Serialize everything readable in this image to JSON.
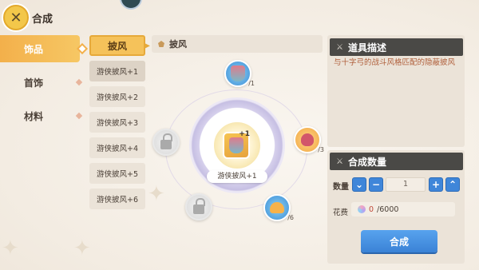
{
  "header": {
    "title": "合成",
    "close_icon": "close-x-icon"
  },
  "categories": [
    {
      "label": "饰品",
      "active": true
    },
    {
      "label": "首饰",
      "active": false
    },
    {
      "label": "材料",
      "active": false
    }
  ],
  "subcategory": {
    "label": "披风"
  },
  "sub_items": [
    "游侠披风+1",
    "游侠披风+2",
    "游侠披风+3",
    "游侠披风+4",
    "游侠披风+5",
    "游侠披风+6"
  ],
  "panel": {
    "title": "披风"
  },
  "center": {
    "label": "游侠披风+1",
    "plus": "+1"
  },
  "materials": [
    {
      "icon": "cape-icon",
      "count": "/1",
      "color": "blue"
    },
    {
      "icon": "ornament-icon",
      "count": "/3",
      "color": "orange"
    },
    {
      "icon": "mushroom-icon",
      "count": "/6",
      "color": "blue"
    },
    {
      "icon": "lock-icon",
      "count": "",
      "color": "grey"
    },
    {
      "icon": "lock-icon",
      "count": "",
      "color": "grey"
    }
  ],
  "description": {
    "title": "道具描述",
    "text": "与十字弓的战斗风格匹配的隐蔽披风"
  },
  "craft": {
    "title": "合成数量",
    "qty_label": "数量",
    "qty_value": "1",
    "cost_label": "花费",
    "cost_current": "0",
    "cost_total": "/6000",
    "button": "合成"
  },
  "colors": {
    "accent": "#f5c25a",
    "primary": "#3f86d9",
    "dark_header": "#4a4946"
  }
}
